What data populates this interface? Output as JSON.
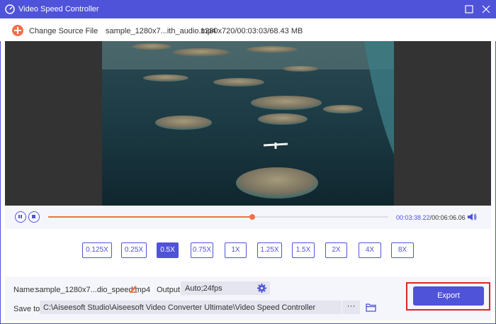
{
  "window": {
    "title": "Video Speed Controller",
    "app_icon": "speed-gauge-icon",
    "maximize_icon": "maximize-icon",
    "close_icon": "close-icon",
    "accent_color": "#4f53d9",
    "highlight_color": "#f0704a"
  },
  "source": {
    "change_label": "Change Source File",
    "add_icon": "plus-circle-icon",
    "file_name": "sample_1280x7...ith_audio.mp4",
    "file_info": "1280x720/00:03:03/68.43 MB"
  },
  "player": {
    "pause_icon": "pause-icon",
    "stop_icon": "stop-icon",
    "volume_icon": "volume-icon",
    "progress_fraction": 0.6,
    "current_time": "00:03:38.22",
    "separator": "/",
    "total_time": "00:06:06.06"
  },
  "speeds": {
    "options": [
      "0.125X",
      "0.25X",
      "0.5X",
      "0.75X",
      "1X",
      "1.25X",
      "1.5X",
      "2X",
      "4X",
      "8X"
    ],
    "selected": "0.5X"
  },
  "output_panel": {
    "name_label": "Name:",
    "name_value": "sample_1280x7...dio_speed.mp4",
    "edit_icon": "pencil-icon",
    "output_label": "Output:",
    "output_value": "Auto;24fps",
    "settings_icon": "gear-icon",
    "save_label": "Save to:",
    "save_path": "C:\\Aiseesoft Studio\\Aiseesoft Video Converter Ultimate\\Video Speed Controller",
    "browse_label": "···",
    "folder_icon": "folder-icon",
    "export_label": "Export",
    "export_highlight_color": "#e02424"
  }
}
